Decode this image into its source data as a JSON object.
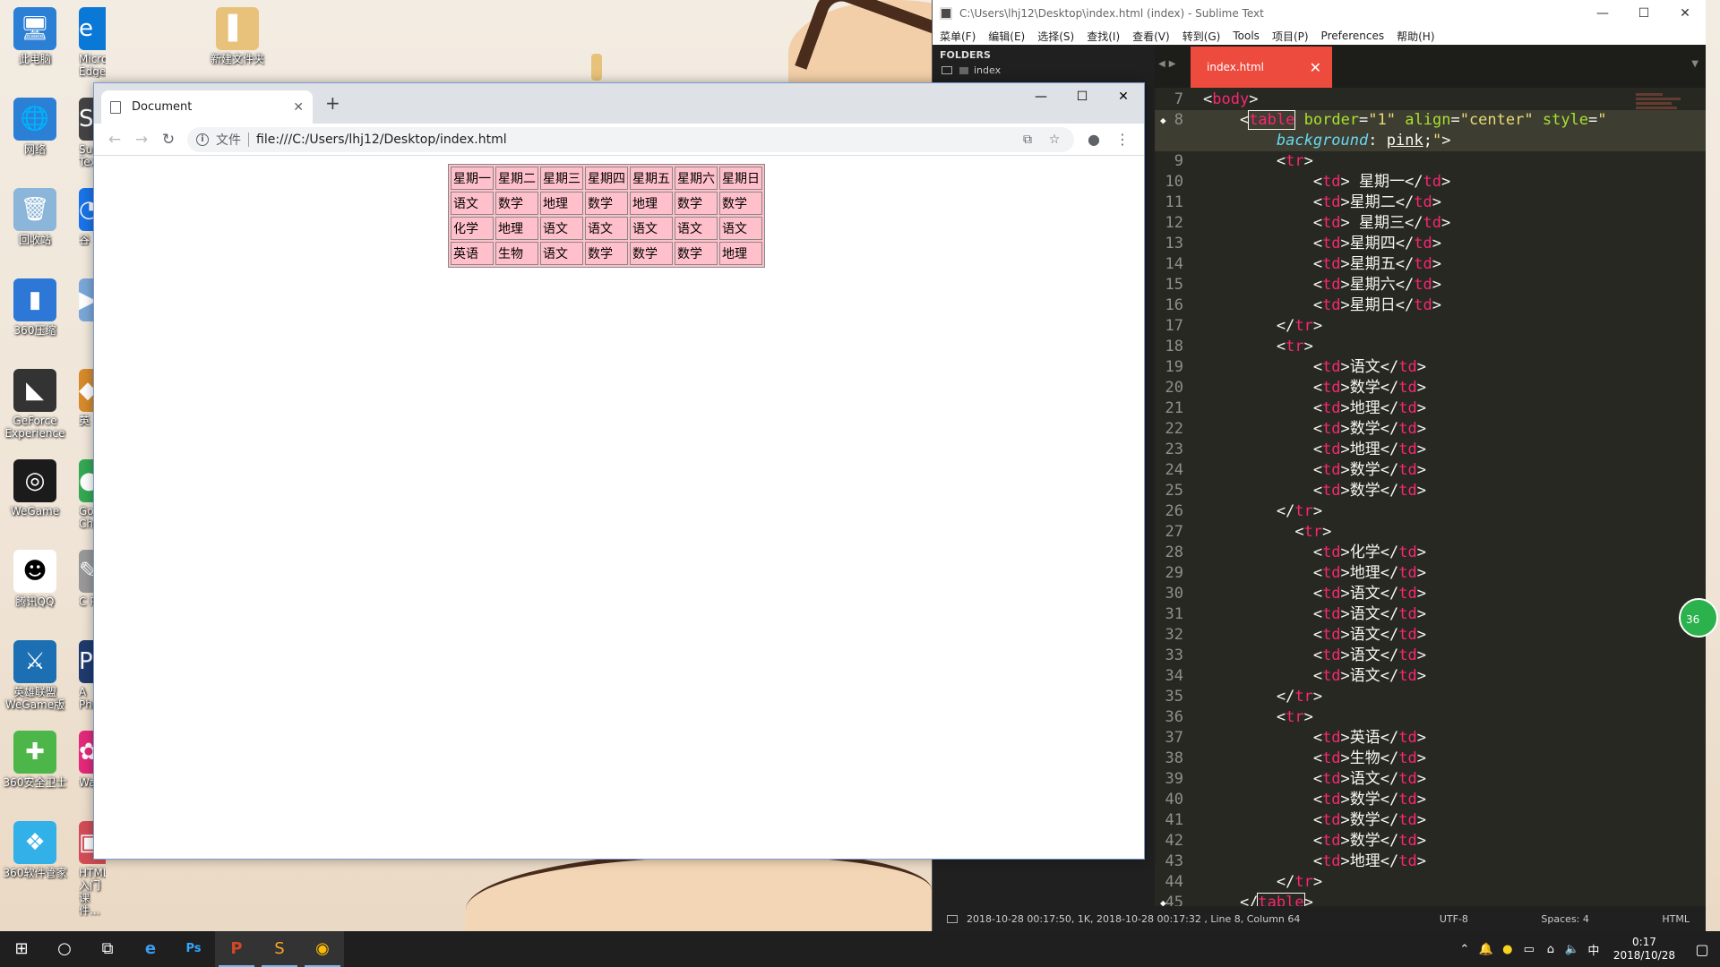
{
  "desktop": {
    "icons": [
      {
        "label": "此电脑",
        "glyph": "🖥",
        "color": "#2b7fd4"
      },
      {
        "label": "网络",
        "glyph": "🌐",
        "color": "#2b7fd4"
      },
      {
        "label": "回收站",
        "glyph": "🗑",
        "color": "#8bb5d9"
      },
      {
        "label": "360压缩",
        "glyph": "▮",
        "color": "#2d77d6"
      },
      {
        "label": "GeForce Experience",
        "glyph": "◣",
        "color": "#333333"
      },
      {
        "label": "WeGame",
        "glyph": "◎",
        "color": "#1b1b1b"
      },
      {
        "label": "腾讯QQ",
        "glyph": "☻",
        "color": "#ffffff"
      },
      {
        "label": "英雄联盟 WeGame版",
        "glyph": "⚔",
        "color": "#1c6fb3"
      },
      {
        "label": "360安全卫士",
        "glyph": "✚",
        "color": "#4cb748"
      },
      {
        "label": "360软件管家",
        "glyph": "❖",
        "color": "#32b0e8"
      }
    ],
    "icons_col2": [
      {
        "label": "Microsoft Edge",
        "glyph": "e",
        "color": "#0a78d7"
      },
      {
        "label": "Su Tex",
        "glyph": "S",
        "color": "#444444"
      },
      {
        "label": "谷",
        "glyph": "◔",
        "color": "#1a73e8"
      },
      {
        "label": "",
        "glyph": "▶",
        "color": "#7aa7d8"
      },
      {
        "label": "英",
        "glyph": "◆",
        "color": "#d68a2b"
      },
      {
        "label": "Go Chr",
        "glyph": "●",
        "color": "#34a853"
      },
      {
        "label": "C Pa",
        "glyph": "✎",
        "color": "#999999"
      },
      {
        "label": "A Pho",
        "glyph": "Ps",
        "color": "#1f3a6e"
      },
      {
        "label": "War",
        "glyph": "✿",
        "color": "#e4287a"
      },
      {
        "label": "HTML+CSS 入门课件...",
        "glyph": "▣",
        "color": "#d24d57"
      }
    ],
    "icons_col3": [
      {
        "label": "新建文件夹",
        "glyph": "▌",
        "color": "#e8c27a"
      }
    ]
  },
  "chrome": {
    "tab_title": "Document",
    "scheme_label": "文件",
    "url": "file:///C:/Users/lhj12/Desktop/index.html",
    "table": [
      [
        "星期一",
        "星期二",
        "星期三",
        "星期四",
        "星期五",
        "星期六",
        "星期日"
      ],
      [
        "语文",
        "数学",
        "地理",
        "数学",
        "地理",
        "数学",
        "数学"
      ],
      [
        "化学",
        "地理",
        "语文",
        "语文",
        "语文",
        "语文",
        "语文"
      ],
      [
        "英语",
        "生物",
        "语文",
        "数学",
        "数学",
        "数学",
        "地理"
      ]
    ]
  },
  "sublime": {
    "title": "C:\\Users\\lhj12\\Desktop\\index.html (index) - Sublime Text",
    "menu": [
      "菜单(F)",
      "编辑(E)",
      "选择(S)",
      "查找(I)",
      "查看(V)",
      "转到(G)",
      "Tools",
      "项目(P)",
      "Preferences",
      "帮助(H)"
    ],
    "sidebar_heading": "FOLDERS",
    "folder": "index",
    "tab": "index.html",
    "status": {
      "info": "2018-10-28 00:17:50, 1K, 2018-10-28 00:17:32 , Line 8, Column 64",
      "encoding": "UTF-8",
      "spaces": "Spaces: 4",
      "syntax": "HTML"
    }
  },
  "taskbar": {
    "time": "0:17",
    "date": "2018/10/28",
    "ime": "中"
  }
}
